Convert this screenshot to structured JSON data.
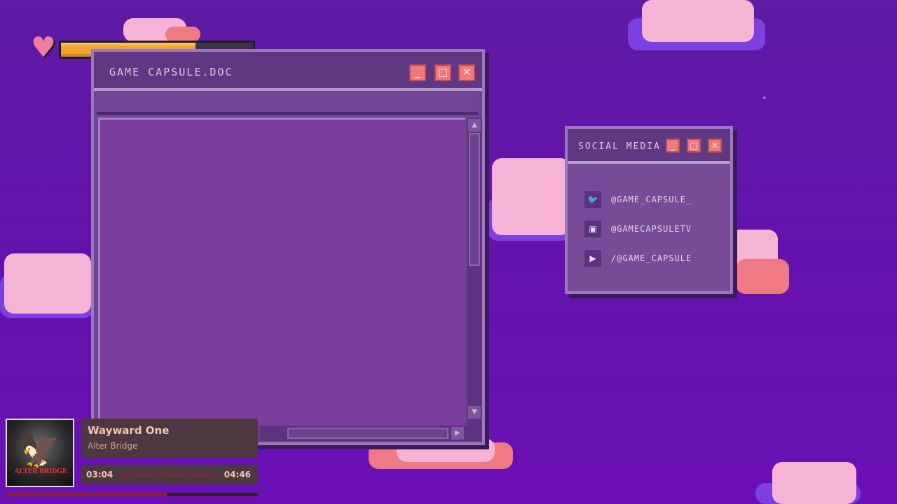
{
  "health_bar": {
    "fill_percent": 70
  },
  "main_window": {
    "title": "GAME CAPSULE.DOC",
    "controls": {
      "minimize": "_",
      "maximize": "□",
      "close": "✕"
    },
    "scroll_up": "▲",
    "scroll_down": "▼",
    "scroll_right": "▶"
  },
  "social_window": {
    "title": "SOCIAL MEDIA",
    "controls": {
      "minimize": "_",
      "maximize": "□",
      "close": "✕"
    },
    "items": [
      {
        "icon": "twitter-icon",
        "glyph": "🐦",
        "handle": "@GAME_CAPSULE_"
      },
      {
        "icon": "twitch-icon",
        "glyph": "▣",
        "handle": "@GAMECAPSULETV"
      },
      {
        "icon": "youtube-icon",
        "glyph": "▶",
        "handle": "/@GAME_CAPSULE"
      }
    ]
  },
  "music_player": {
    "album_logo": "ALTER BRIDGE",
    "track_title": "Wayward One",
    "artist": "Alter Bridge",
    "current_time": "03:04",
    "total_time": "04:46",
    "progress_fraction": 0.64
  },
  "colors": {
    "background": "#6412ad",
    "window_button": "#f07a7a",
    "health_fill": "#f2a431"
  }
}
